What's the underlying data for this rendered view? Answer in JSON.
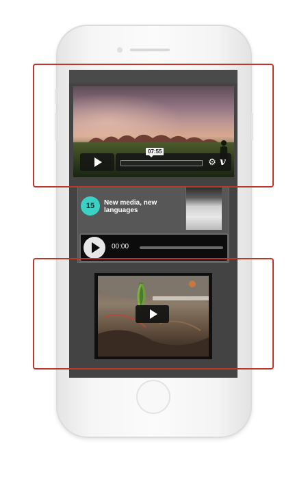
{
  "video_player": {
    "timestamp": "07:55",
    "settings_icon": "gear-icon",
    "brand_icon": "vimeo-icon",
    "brand_glyph": "v"
  },
  "podcast_card": {
    "episode_number": "15",
    "title": "New media, new languages",
    "audio_time": "00:00"
  },
  "colors": {
    "screen_bg": "#434343",
    "badge": "#3bd1c4",
    "highlight": "#c1342b"
  }
}
